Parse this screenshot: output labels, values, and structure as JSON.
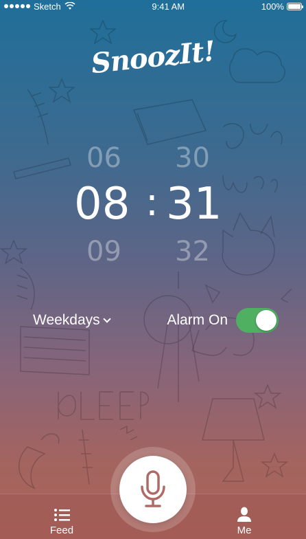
{
  "status_bar": {
    "carrier": "Sketch",
    "time": "9:41 AM",
    "battery_percent": "100%",
    "battery_level": 1.0
  },
  "logo": {
    "text": "SnoozIt!"
  },
  "time_picker": {
    "hour_prev": "06",
    "hour_current": "08",
    "hour_next": "09",
    "minute_prev": "30",
    "minute_current": "31",
    "minute_next": "32",
    "separator": ":"
  },
  "controls": {
    "repeat_label": "Weekdays",
    "alarm_label": "Alarm On",
    "alarm_enabled": true
  },
  "tab_bar": {
    "feed_label": "Feed",
    "me_label": "Me"
  },
  "colors": {
    "toggle_on": "#4fb061",
    "mic_icon": "#b06a66",
    "gradient_top": "#1f6f9a",
    "gradient_bottom": "#a86257"
  },
  "icons": {
    "wifi": "wifi-icon",
    "feed": "list-icon",
    "me": "user-icon",
    "mic": "microphone-icon",
    "chevron": "chevron-down-icon"
  }
}
